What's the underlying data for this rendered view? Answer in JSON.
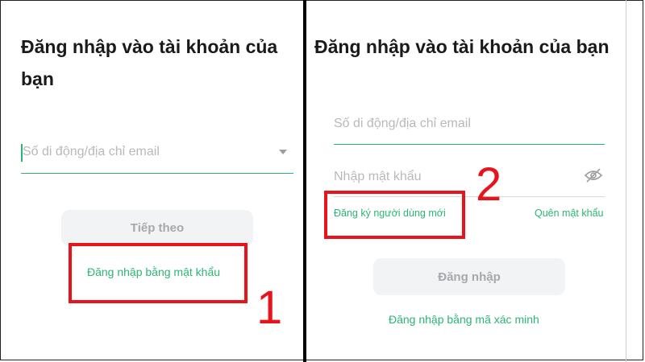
{
  "left_panel": {
    "title": "Đăng nhập vào tài khoản của bạn",
    "phone_input": {
      "placeholder": "Số di động/địa chỉ email",
      "icon": "chevron-down-icon"
    },
    "next_button": {
      "label": "Tiếp theo"
    },
    "password_login_link": {
      "label": "Đăng nhập bằng mật khẩu"
    },
    "annotation": {
      "number": "1"
    }
  },
  "right_panel": {
    "title": "Đăng nhập vào tài khoản của bạn",
    "phone_input": {
      "placeholder": "Số di động/địa chỉ email"
    },
    "password_input": {
      "placeholder": "Nhập mật khẩu",
      "icon": "eye-off-icon"
    },
    "register_link": {
      "label": "Đăng ký người dùng mới"
    },
    "forgot_link": {
      "label": "Quên mật khẩu"
    },
    "login_button": {
      "label": "Đăng nhập"
    },
    "code_login_link": {
      "label": "Đăng nhập bằng mã xác minh"
    },
    "annotation": {
      "number": "2"
    }
  },
  "colors": {
    "accent": "#2bb673",
    "annotation": "#e8141c",
    "button_bg": "#f2f3f5",
    "button_text": "#a6a8ad"
  }
}
